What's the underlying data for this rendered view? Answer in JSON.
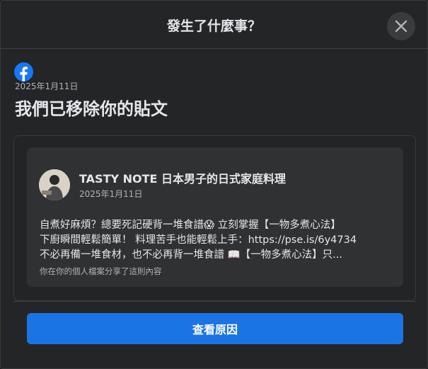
{
  "dialog": {
    "title": "發生了什麼事？",
    "close_icon": "close-icon"
  },
  "notice": {
    "logo_icon": "facebook-logo-icon",
    "date": "2025年1月11日",
    "title": "我們已移除你的貼文"
  },
  "post": {
    "author": "TASTY NOTE 日本男子的日式家庭料理",
    "date": "2025年1月11日",
    "lines": [
      "自煮好麻煩？總要死記硬背一堆食譜😱 立刻掌握【一物多煮心法】",
      "下廚瞬間輕鬆簡單！ 料理苦手也能輕鬆上手：https://pse.is/6y4734",
      "不必再備一堆食材，也不必再背一堆食譜 📖【一物多煮心法】只..."
    ],
    "shared_note": "你在你的個人檔案分享了這則內容"
  },
  "actions": {
    "see_why_label": "查看原因"
  },
  "colors": {
    "background": "#242526",
    "card": "#303133",
    "primary_button": "#1b74e4",
    "facebook_blue": "#1877f2"
  }
}
